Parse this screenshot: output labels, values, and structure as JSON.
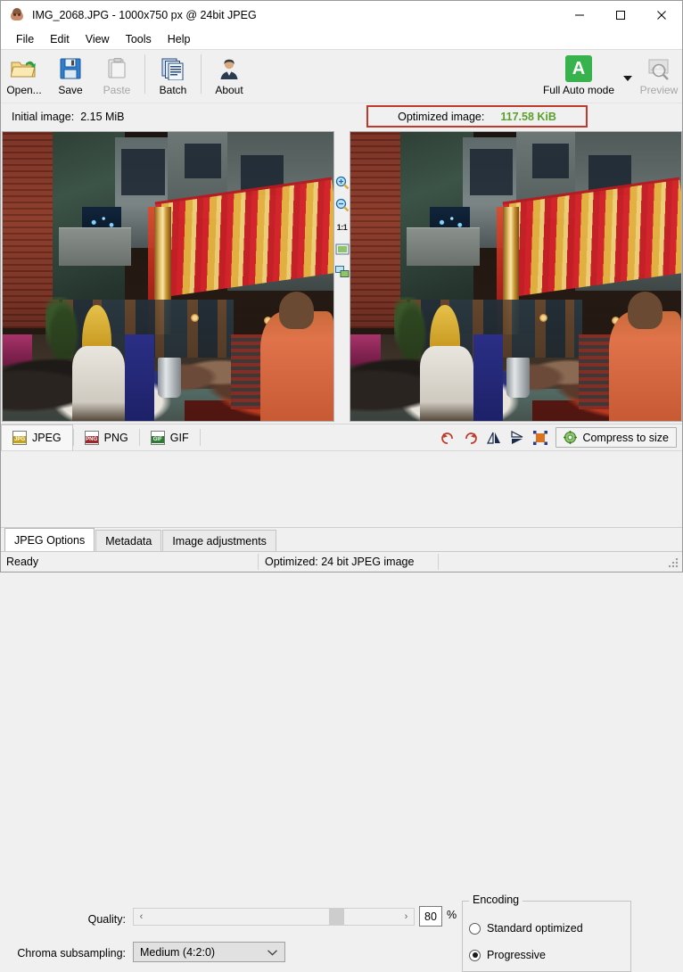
{
  "window": {
    "title": "IMG_2068.JPG - 1000x750 px @ 24bit JPEG",
    "app_icon": "riot-app-icon",
    "minimize": "–",
    "maximize": "□",
    "close": "✕"
  },
  "menu": {
    "items": [
      {
        "label": "File"
      },
      {
        "label": "Edit"
      },
      {
        "label": "View"
      },
      {
        "label": "Tools"
      },
      {
        "label": "Help"
      }
    ]
  },
  "toolbar": {
    "buttons": [
      {
        "label": "Open...",
        "icon": "open-folder-icon",
        "enabled": true
      },
      {
        "label": "Save",
        "icon": "floppy-disk-icon",
        "enabled": true
      },
      {
        "label": "Paste",
        "icon": "clipboard-icon",
        "enabled": false
      },
      {
        "label": "Batch",
        "icon": "batch-documents-icon",
        "enabled": true
      },
      {
        "label": "About",
        "icon": "person-icon",
        "enabled": true
      }
    ],
    "mode": {
      "label": "Full Auto mode",
      "icon_letter": "A",
      "icon_color": "#37b24d",
      "dropdown": "chevron-down-icon"
    },
    "preview": {
      "label": "Preview",
      "icon": "magnifier-image-icon",
      "enabled": false
    }
  },
  "infobar": {
    "initial_label": "Initial image:",
    "initial_value": "2.15 MiB",
    "optimized_label": "Optimized image:",
    "optimized_value": "117.58 KiB",
    "optimized_value_color": "#5aa02c",
    "highlight_border_color": "#c0392b"
  },
  "viewer": {
    "zoom_tools": [
      {
        "name": "zoom-in-icon"
      },
      {
        "name": "zoom-out-icon"
      },
      {
        "name": "actual-size-label",
        "label": "1:1"
      },
      {
        "name": "fit-to-window-icon"
      },
      {
        "name": "side-by-side-view-icon"
      }
    ],
    "left_pane_alt": "Original image preview",
    "right_pane_alt": "Optimized image preview"
  },
  "format_tabs": {
    "items": [
      {
        "label": "JPEG",
        "icon": "jpg-file-icon",
        "tag": "JPG",
        "active": true
      },
      {
        "label": "PNG",
        "icon": "png-file-icon",
        "tag": "PNG",
        "active": false
      },
      {
        "label": "GIF",
        "icon": "gif-file-icon",
        "tag": "GIF",
        "active": false
      }
    ],
    "tools": [
      {
        "name": "rotate-left-icon"
      },
      {
        "name": "rotate-right-icon"
      },
      {
        "name": "flip-horizontal-icon"
      },
      {
        "name": "flip-vertical-icon"
      },
      {
        "name": "resize-icon"
      }
    ],
    "compress_button": {
      "label": "Compress to size",
      "icon": "compress-gear-icon"
    }
  },
  "jpeg_options": {
    "quality_label": "Quality:",
    "quality_value": "80",
    "percent_symbol": "%",
    "slider_left_arrow": "‹",
    "slider_right_arrow": "›",
    "chroma_label": "Chroma subsampling:",
    "chroma_value": "Medium (4:2:0)",
    "encoding_legend": "Encoding",
    "encoding_options": [
      {
        "label": "Standard optimized",
        "selected": false
      },
      {
        "label": "Progressive",
        "selected": true
      }
    ]
  },
  "bottom_tabs": {
    "items": [
      {
        "label": "JPEG Options",
        "active": true
      },
      {
        "label": "Metadata",
        "active": false
      },
      {
        "label": "Image adjustments",
        "active": false
      }
    ]
  },
  "statusbar": {
    "left": "Ready",
    "right": "Optimized: 24 bit JPEG image"
  }
}
